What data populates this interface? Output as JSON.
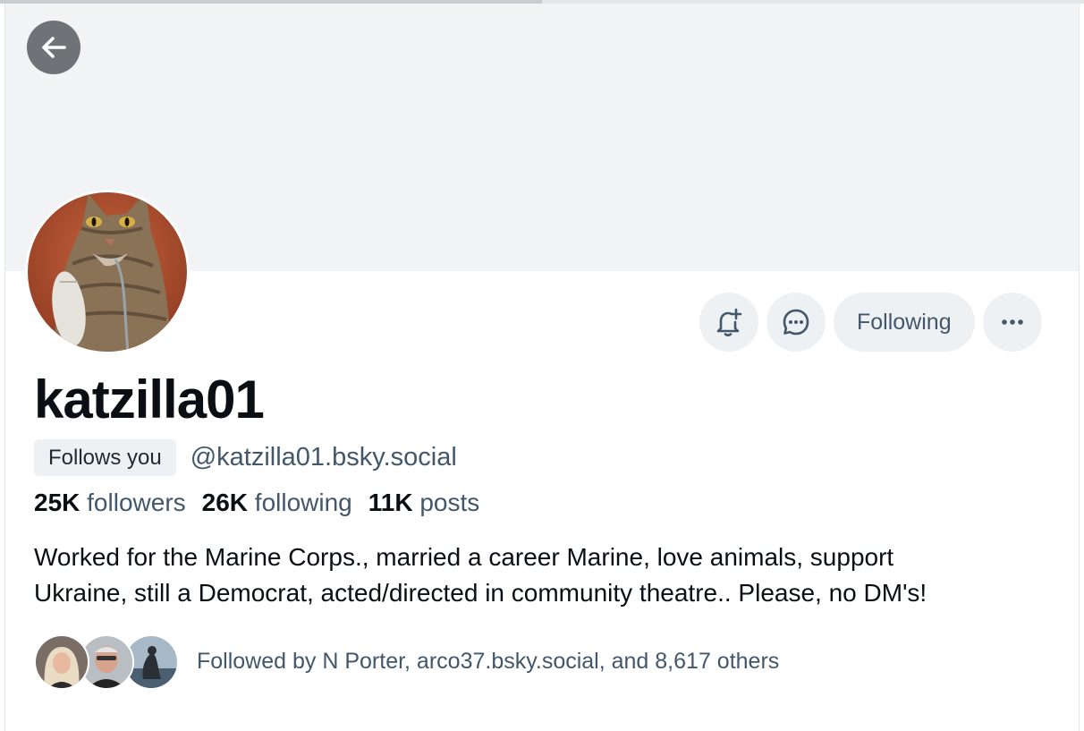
{
  "profile": {
    "display_name": "katzilla01",
    "follows_you_label": "Follows you",
    "handle": "@katzilla01.bsky.social",
    "stats": {
      "followers_count": "25K",
      "followers_label": "followers",
      "following_count": "26K",
      "following_label": "following",
      "posts_count": "11K",
      "posts_label": "posts"
    },
    "bio_line1": "Worked for the Marine Corps., married a career Marine, love animals, support",
    "bio_line2": "Ukraine, still a Democrat, acted/directed in community theatre.. Please, no DM's!",
    "followed_by": "Followed by N Porter, arco37.bsky.social, and 8,617 others"
  },
  "actions": {
    "following_label": "Following"
  },
  "icons": {
    "back": "arrow-left-icon",
    "notify": "bell-plus-icon",
    "message": "chat-bubble-icon",
    "more": "ellipsis-icon"
  },
  "colors": {
    "banner": "#f1f3f5",
    "button_bg": "#eef1f3",
    "secondary_text": "#42576c",
    "primary_text": "#0b0f14"
  }
}
